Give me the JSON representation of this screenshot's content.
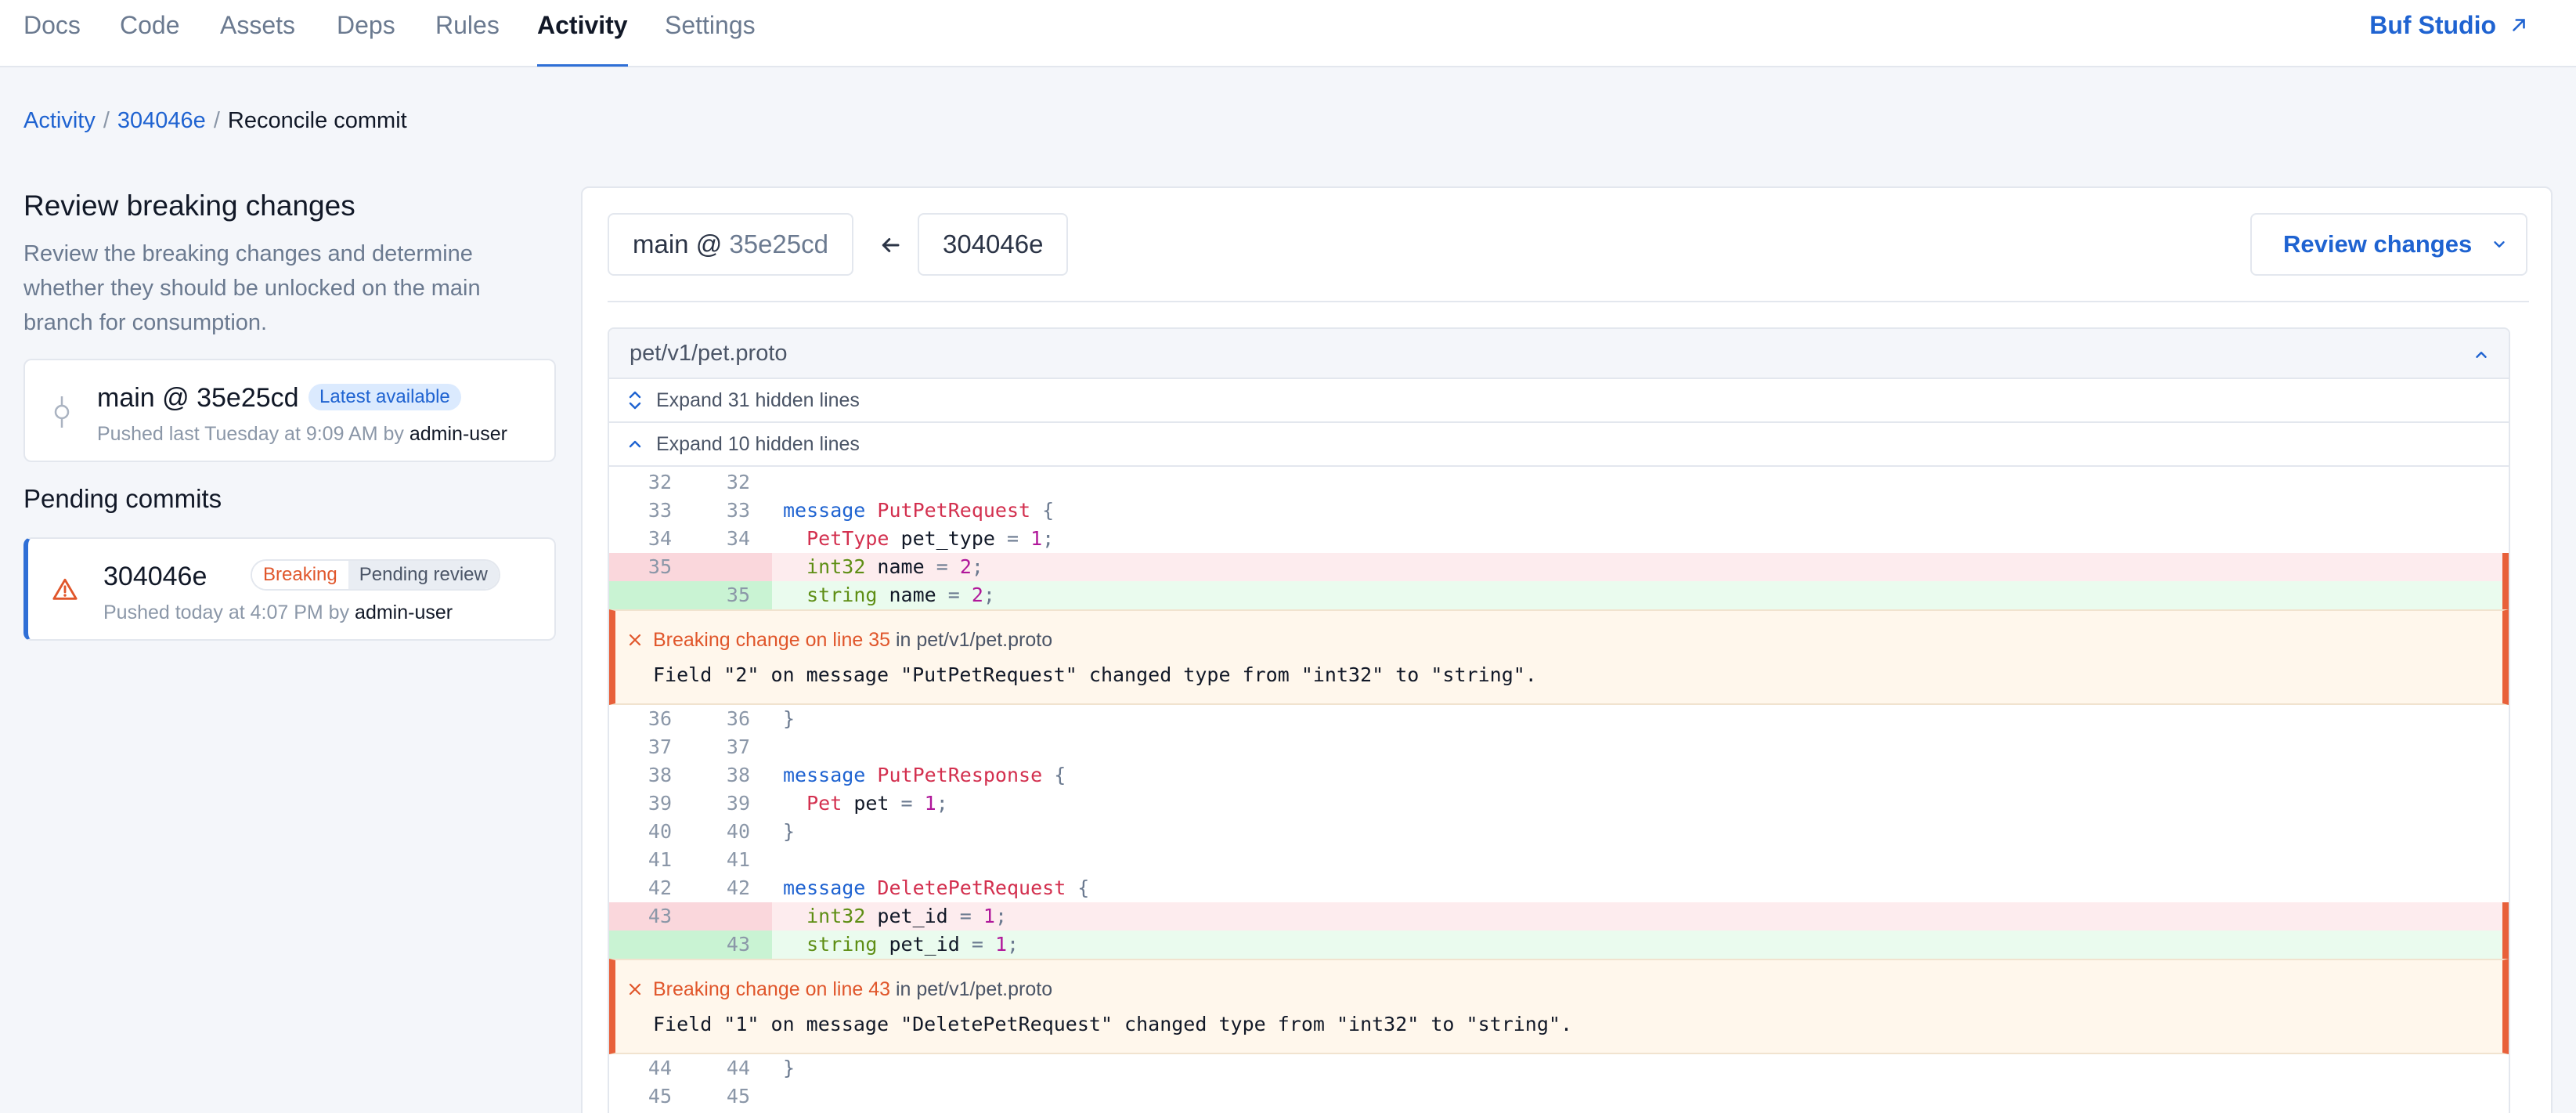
{
  "nav": {
    "tabs": [
      "Docs",
      "Code",
      "Assets",
      "Deps",
      "Rules",
      "Activity",
      "Settings"
    ],
    "active": "Activity",
    "studio_link": "Buf Studio"
  },
  "breadcrumb": {
    "root": "Activity",
    "commit": "304046e",
    "current": "Reconcile commit"
  },
  "left": {
    "title": "Review breaking changes",
    "description": "Review the breaking changes and determine whether they should be unlocked on the main branch for consumption.",
    "main_card": {
      "ref": "main @ 35e25cd",
      "badge": "Latest available",
      "meta_prefix": "Pushed last Tuesday at 9:09 AM by",
      "user": "admin-user"
    },
    "pending_title": "Pending commits",
    "pending_card": {
      "ref": "304046e",
      "badge_breaking": "Breaking",
      "badge_pending": "Pending review",
      "meta_prefix": "Pushed today at 4:07 PM by",
      "user": "admin-user"
    }
  },
  "compare": {
    "base_branch": "main @",
    "base_sha": "35e25cd",
    "head": "304046e",
    "review_button": "Review changes"
  },
  "file": {
    "path": "pet/v1/pet.proto",
    "expand_1": "Expand 31 hidden lines",
    "expand_2": "Expand 10 hidden lines",
    "warning_1": {
      "title_highlight": "Breaking change on line 35",
      "title_suffix": " in pet/v1/pet.proto",
      "message": "Field \"2\" on message \"PutPetRequest\" changed type from \"int32\" to \"string\"."
    },
    "warning_2": {
      "title_highlight": "Breaking change on line 43",
      "title_suffix": " in pet/v1/pet.proto",
      "message": "Field \"1\" on message \"DeletePetRequest\" changed type from \"int32\" to \"string\"."
    },
    "lines_a": [
      {
        "old": "32",
        "new": "32",
        "kind": "ctx",
        "tokens": []
      },
      {
        "old": "33",
        "new": "33",
        "kind": "ctx",
        "tokens": [
          [
            "kw",
            "message"
          ],
          [
            "",
            " "
          ],
          [
            "ty",
            "PutPetRequest"
          ],
          [
            "pun",
            " {"
          ]
        ]
      },
      {
        "old": "34",
        "new": "34",
        "kind": "ctx",
        "tokens": [
          [
            "",
            "  "
          ],
          [
            "ty",
            "PetType"
          ],
          [
            "",
            " pet_type "
          ],
          [
            "pun",
            "="
          ],
          [
            "",
            " "
          ],
          [
            "num",
            "1"
          ],
          [
            "pun",
            ";"
          ]
        ]
      },
      {
        "old": "35",
        "new": "",
        "kind": "del",
        "tokens": [
          [
            "",
            "  "
          ],
          [
            "scal",
            "int32"
          ],
          [
            "",
            " name "
          ],
          [
            "pun",
            "="
          ],
          [
            "",
            " "
          ],
          [
            "num",
            "2"
          ],
          [
            "pun",
            ";"
          ]
        ]
      },
      {
        "old": "",
        "new": "35",
        "kind": "add",
        "tokens": [
          [
            "",
            "  "
          ],
          [
            "scal",
            "string"
          ],
          [
            "",
            " name "
          ],
          [
            "pun",
            "="
          ],
          [
            "",
            " "
          ],
          [
            "num",
            "2"
          ],
          [
            "pun",
            ";"
          ]
        ]
      }
    ],
    "lines_b": [
      {
        "old": "36",
        "new": "36",
        "kind": "ctx",
        "tokens": [
          [
            "pun",
            "}"
          ]
        ]
      },
      {
        "old": "37",
        "new": "37",
        "kind": "ctx",
        "tokens": []
      },
      {
        "old": "38",
        "new": "38",
        "kind": "ctx",
        "tokens": [
          [
            "kw",
            "message"
          ],
          [
            "",
            " "
          ],
          [
            "ty",
            "PutPetResponse"
          ],
          [
            "pun",
            " {"
          ]
        ]
      },
      {
        "old": "39",
        "new": "39",
        "kind": "ctx",
        "tokens": [
          [
            "",
            "  "
          ],
          [
            "ty",
            "Pet"
          ],
          [
            "",
            " pet "
          ],
          [
            "pun",
            "="
          ],
          [
            "",
            " "
          ],
          [
            "num",
            "1"
          ],
          [
            "pun",
            ";"
          ]
        ]
      },
      {
        "old": "40",
        "new": "40",
        "kind": "ctx",
        "tokens": [
          [
            "pun",
            "}"
          ]
        ]
      },
      {
        "old": "41",
        "new": "41",
        "kind": "ctx",
        "tokens": []
      },
      {
        "old": "42",
        "new": "42",
        "kind": "ctx",
        "tokens": [
          [
            "kw",
            "message"
          ],
          [
            "",
            " "
          ],
          [
            "ty",
            "DeletePetRequest"
          ],
          [
            "pun",
            " {"
          ]
        ]
      },
      {
        "old": "43",
        "new": "",
        "kind": "del",
        "tokens": [
          [
            "",
            "  "
          ],
          [
            "scal",
            "int32"
          ],
          [
            "",
            " pet_id "
          ],
          [
            "pun",
            "="
          ],
          [
            "",
            " "
          ],
          [
            "num",
            "1"
          ],
          [
            "pun",
            ";"
          ]
        ]
      },
      {
        "old": "",
        "new": "43",
        "kind": "add",
        "tokens": [
          [
            "",
            "  "
          ],
          [
            "scal",
            "string"
          ],
          [
            "",
            " pet_id "
          ],
          [
            "pun",
            "="
          ],
          [
            "",
            " "
          ],
          [
            "num",
            "1"
          ],
          [
            "pun",
            ";"
          ]
        ]
      }
    ],
    "lines_c": [
      {
        "old": "44",
        "new": "44",
        "kind": "ctx",
        "tokens": [
          [
            "pun",
            "}"
          ]
        ]
      },
      {
        "old": "45",
        "new": "45",
        "kind": "ctx",
        "tokens": []
      }
    ]
  },
  "colors": {
    "accent": "#1f63d1",
    "breaking": "#e0562b",
    "deleted_bg": "#fdecee",
    "added_bg": "#eafbee"
  }
}
